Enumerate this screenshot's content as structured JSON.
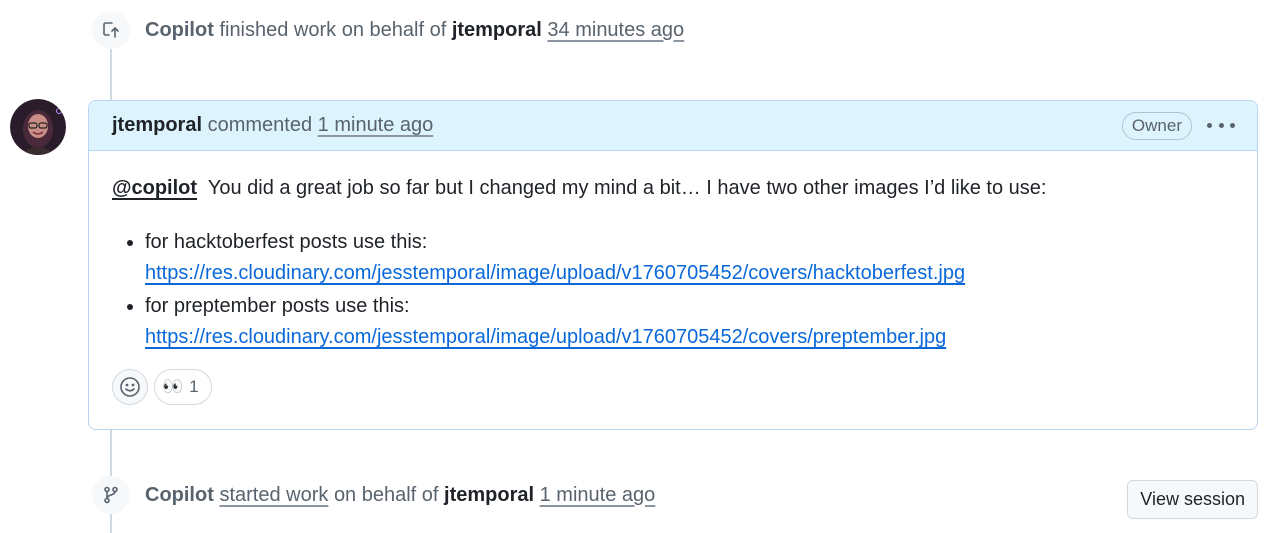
{
  "timeline": {
    "finished_event": {
      "actor": "Copilot",
      "action": "finished work on behalf of",
      "user": "jtemporal",
      "time": "34 minutes ago",
      "icon": "pull-request-close-icon"
    },
    "started_event": {
      "actor": "Copilot",
      "action_link": "started work",
      "action_rest": "on behalf of",
      "user": "jtemporal",
      "time": "1 minute ago",
      "icon": "git-branch-icon",
      "button_label": "View session"
    }
  },
  "comment": {
    "author": "jtemporal",
    "verb": "commented",
    "time": "1 minute ago",
    "role_badge": "Owner",
    "body": {
      "mention": "@copilot",
      "intro": "You did a great job so far but I changed my mind a bit… I have two other images I’d like to use:",
      "items": [
        {
          "text": "for hacktoberfest posts use this:",
          "link": "https://res.cloudinary.com/jesstemporal/image/upload/v1760705452/covers/hacktoberfest.jpg"
        },
        {
          "text": "for preptember posts use this:",
          "link": "https://res.cloudinary.com/jesstemporal/image/upload/v1760705452/covers/preptember.jpg"
        }
      ]
    },
    "reactions": [
      {
        "emoji": "👀",
        "count": "1"
      }
    ]
  },
  "colors": {
    "header_bg": "#ddf4ff",
    "border": "#b6d6f2",
    "link": "#0969da",
    "muted": "#59636e"
  }
}
